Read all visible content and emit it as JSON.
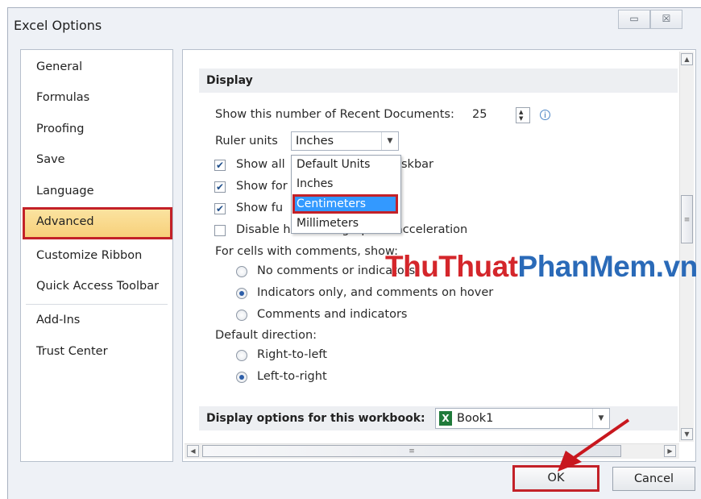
{
  "window": {
    "title": "Excel Options",
    "minimize_glyph": "▭",
    "close_glyph": "☒"
  },
  "nav": {
    "items": [
      {
        "label": "General"
      },
      {
        "label": "Formulas"
      },
      {
        "label": "Proofing"
      },
      {
        "label": "Save"
      },
      {
        "label": "Language"
      },
      {
        "label": "Advanced",
        "selected": true
      },
      {
        "label": "Customize Ribbon"
      },
      {
        "label": "Quick Access Toolbar"
      },
      {
        "label": "Add-Ins"
      },
      {
        "label": "Trust Center"
      }
    ]
  },
  "display": {
    "header": "Display",
    "recent_docs_label": "Show this number of Recent Documents:",
    "recent_docs_value": "25",
    "ruler_label": "Ruler units",
    "ruler_value": "Inches",
    "check_taskbar_pre": "Show all ",
    "check_taskbar_post": "skbar",
    "check_formula_pre": "Show for",
    "check_function_pre": "Show fu",
    "check_hw": "Disable hardware graphics acceleration",
    "comments_label": "For cells with comments, show:",
    "radio_no_comments": "No comments or indicators",
    "radio_indicators": "Indicators only, and comments on hover",
    "radio_comments_and": "Comments and indicators",
    "direction_label": "Default direction:",
    "radio_rtl": "Right-to-left",
    "radio_ltr": "Left-to-right"
  },
  "dropdown": {
    "options": [
      "Default Units",
      "Inches",
      "Centimeters",
      "Millimeters"
    ],
    "highlighted": "Centimeters"
  },
  "workbook": {
    "header": "Display options for this workbook:",
    "book_value": "Book1",
    "excel_icon_letter": "X"
  },
  "watermark": {
    "part1": "ThuThuat",
    "part2": "PhanMem.vn"
  },
  "buttons": {
    "ok": "OK",
    "cancel": "Cancel"
  },
  "colors": {
    "highlight_border": "#c32128",
    "selection_blue": "#3399ff",
    "selected_nav_fill": "#f7d07a",
    "arrow_red": "#c8171e"
  }
}
